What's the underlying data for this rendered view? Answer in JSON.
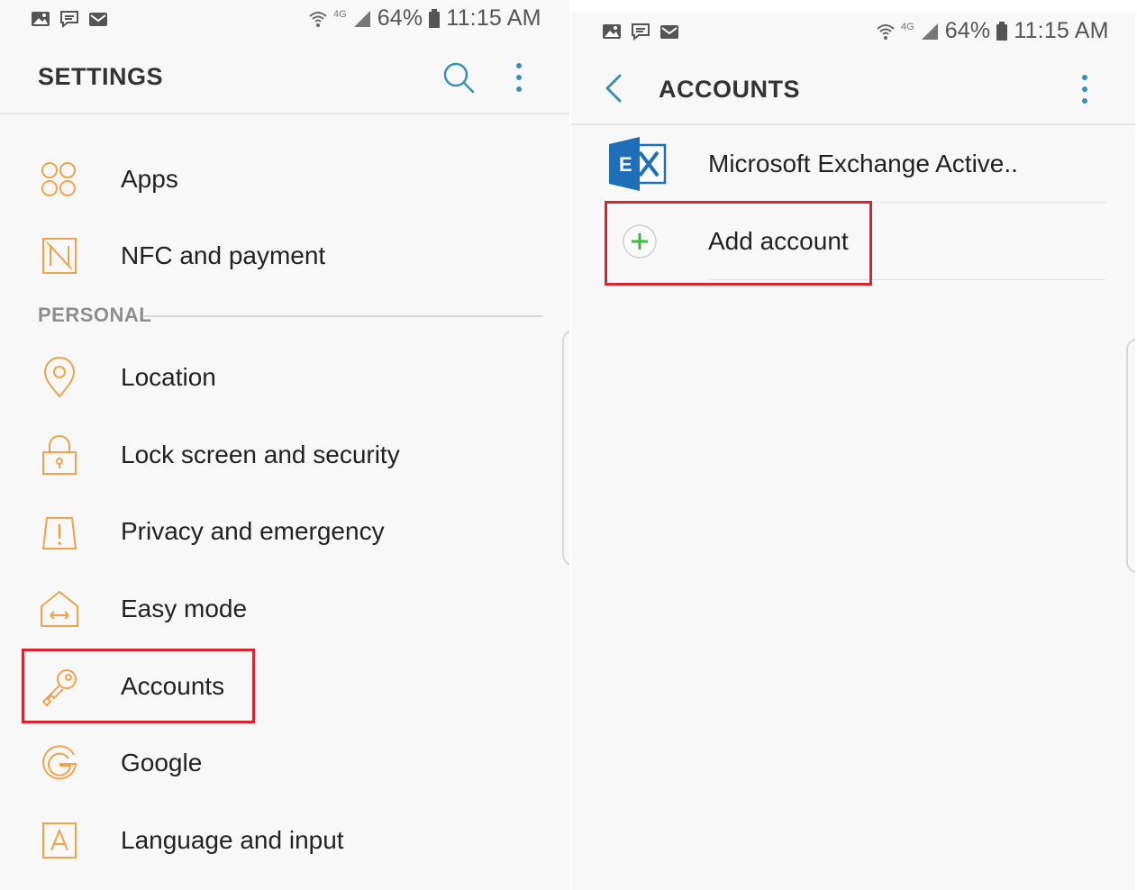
{
  "status_bar": {
    "left_icons": [
      "gallery-icon",
      "message-icon",
      "email-icon"
    ],
    "network": "4G",
    "battery": "64%",
    "time": "11:15 AM"
  },
  "settings": {
    "title": "SETTINGS",
    "items_top": [
      {
        "label": "Apps",
        "icon": "apps-icon"
      },
      {
        "label": "NFC and payment",
        "icon": "nfc-icon"
      }
    ],
    "section": "PERSONAL",
    "items_personal": [
      {
        "label": "Location",
        "icon": "location-icon"
      },
      {
        "label": "Lock screen and security",
        "icon": "lock-icon"
      },
      {
        "label": "Privacy and emergency",
        "icon": "warning-icon"
      },
      {
        "label": "Easy mode",
        "icon": "home-icon"
      },
      {
        "label": "Accounts",
        "icon": "key-icon"
      },
      {
        "label": "Google",
        "icon": "google-icon"
      },
      {
        "label": "Language and input",
        "icon": "language-icon"
      }
    ]
  },
  "accounts": {
    "title": "ACCOUNTS",
    "items": [
      {
        "label": "Microsoft Exchange Active..",
        "icon": "exchange-icon",
        "icon_letter": "E"
      },
      {
        "label": "Add account",
        "icon": "add-icon"
      }
    ]
  },
  "colors": {
    "icon_orange": "#f0a34a",
    "accent_teal": "#3a8fb7",
    "highlight_red": "#d7252f",
    "add_green": "#3dbb3d",
    "exchange_blue": "#1f6fb8"
  }
}
